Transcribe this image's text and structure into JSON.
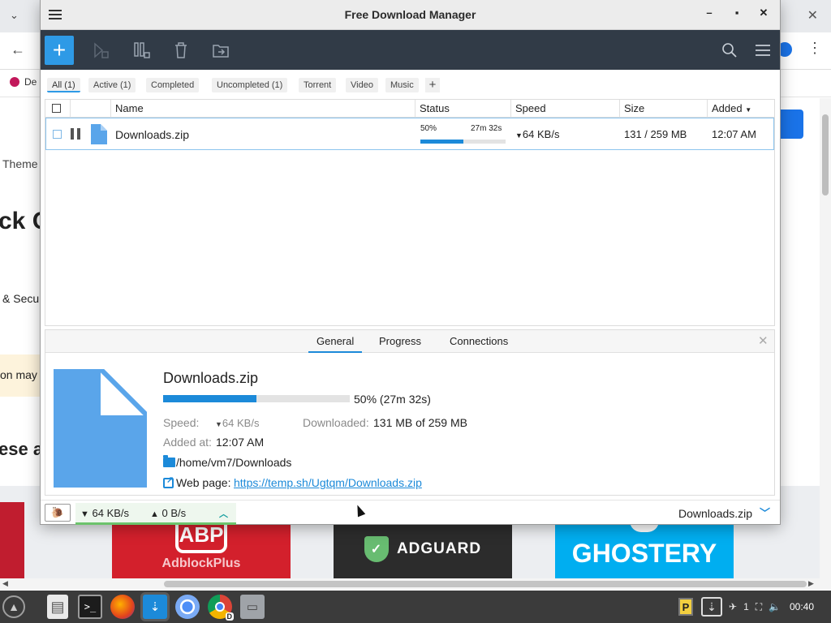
{
  "browser_bg": {
    "bookmark_label": "De",
    "text_themes": "Theme",
    "text_heading1": "ck C",
    "text_security": "& Secu",
    "text_notice": "on may",
    "text_heading2": "ese a",
    "card_abp_label": "ABP",
    "card_abp_sub": "AdblockPlus",
    "card_adguard_label": "ADGUARD",
    "card_ghostery_label": "GHOSTERY"
  },
  "window": {
    "title": "Free Download Manager"
  },
  "filters": [
    {
      "label": "All (1)",
      "active": true
    },
    {
      "label": "Active (1)",
      "active": false
    },
    {
      "label": "Completed",
      "active": false
    },
    {
      "label": "Uncompleted (1)",
      "active": false
    },
    {
      "label": "Torrent",
      "active": false
    },
    {
      "label": "Video",
      "active": false
    },
    {
      "label": "Music",
      "active": false
    }
  ],
  "columns": {
    "name": "Name",
    "status": "Status",
    "speed": "Speed",
    "size": "Size",
    "added": "Added"
  },
  "downloads": [
    {
      "name": "Downloads.zip",
      "progress_label": "50%",
      "progress": 0.5,
      "eta": "27m 32s",
      "speed": "64 KB/s",
      "size": "131 / 259 MB",
      "added": "12:07 AM"
    }
  ],
  "details": {
    "tabs": [
      "General",
      "Progress",
      "Connections"
    ],
    "file_name": "Downloads.zip",
    "progress": 0.5,
    "progress_text": "50% (27m 32s)",
    "speed_label": "Speed:",
    "speed_value": "64 KB/s",
    "downloaded_label": "Downloaded:",
    "downloaded_value": "131 MB of 259 MB",
    "added_label": "Added at:",
    "added_value": "12:07 AM",
    "folder": "/home/vm7/Downloads",
    "webpage_label": "Web page:",
    "webpage_url": "https://temp.sh/Ugtqm/Downloads.zip"
  },
  "statusbar": {
    "download_speed": "64 KB/s",
    "upload_speed": "0 B/s",
    "current_file": "Downloads.zip"
  },
  "taskbar": {
    "tray_count": "1",
    "clock": "00:40"
  },
  "colors": {
    "accent": "#1c8ad9",
    "toolbar_bg": "#313b47",
    "add_button": "#2e9ae6"
  }
}
